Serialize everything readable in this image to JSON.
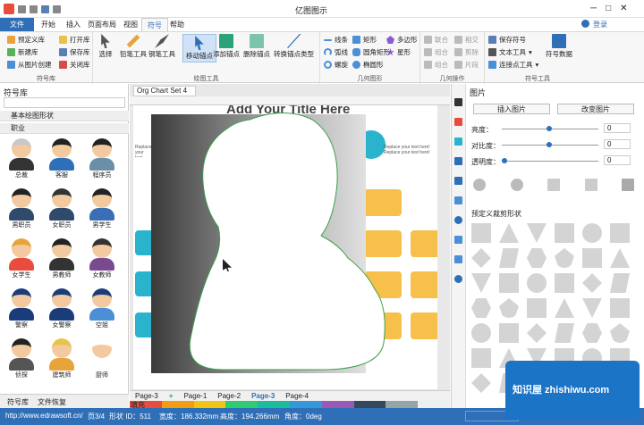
{
  "window": {
    "title": "亿图图示",
    "signin": "登录"
  },
  "menu": [
    "文件",
    "开始",
    "插入",
    "页面布局",
    "视图",
    "符号",
    "帮助"
  ],
  "ribbon": {
    "group1": {
      "items": [
        "预定义库",
        "新建库",
        "从图片创建",
        "打开库",
        "保存库",
        "关闭库"
      ],
      "title": "符号库"
    },
    "group2": {
      "items": [
        "选择",
        "铅笔工具",
        "钢笔工具",
        "移动锚点",
        "添加锚点",
        "删除锚点",
        "转换锚点类型"
      ],
      "title": "绘图工具"
    },
    "group3": {
      "items": [
        "线条",
        "弧线",
        "螺旋",
        "矩形",
        "圆角矩形",
        "椭圆形",
        "多边形",
        "星形"
      ],
      "title": "几何图形"
    },
    "group4": {
      "items": [
        "联合",
        "组合",
        "相交",
        "剪除",
        "片段",
        "组合"
      ],
      "title": "几何操作"
    },
    "group5": {
      "items": [
        "保存符号",
        "文本工具",
        "连接点工具",
        "符号数据"
      ],
      "title": "符号工具"
    }
  },
  "left": {
    "title": "符号库",
    "sections": [
      "基本绘图形状",
      "职业"
    ],
    "people": [
      "总裁",
      "客服",
      "程序员",
      "男职员",
      "女职员",
      "男学生",
      "女学生",
      "男教师",
      "女教师",
      "警察",
      "女警察",
      "空姐",
      "侦探",
      "建筑师",
      "厨师"
    ],
    "bottomtabs": [
      "符号库",
      "文件恢复"
    ]
  },
  "canvas": {
    "tab": "Org Chart Set 4",
    "title": "Add Your Title Here",
    "placeholder": "Replace your text here! Replace your text here!",
    "pages": [
      "Page-3",
      "Page-1",
      "Page-2",
      "Page-3",
      "Page-4"
    ]
  },
  "right": {
    "title": "图片",
    "insert": "插入图片",
    "change": "改变图片",
    "brightness": "亮度：",
    "contrast": "对比度：",
    "transparency": "透明度：",
    "zero": "0",
    "crop_title": "预定义裁剪形状"
  },
  "status": {
    "url": "http://www.edrawsoft.cn/",
    "page": "页3/4",
    "shape": "形状 ID：511",
    "width": "宽度：186.332mm",
    "height": "高度：194.266mm",
    "angle": "角度：0deg",
    "fill": "填充"
  },
  "accent": "#2f6fb7",
  "watermark": "知识屋 zhishiwu.com"
}
